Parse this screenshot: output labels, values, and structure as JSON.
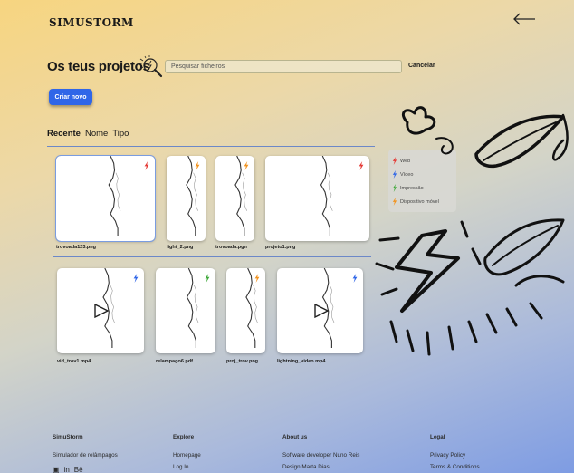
{
  "brand": "SIMUSTORM",
  "header": {
    "title": "Os teus projetos"
  },
  "search": {
    "placeholder": "Pesquisar ficheiros",
    "value": "",
    "cancel_label": "Cancelar"
  },
  "new_button_label": "Criar novo",
  "sort_tabs": [
    "Recente",
    "Nome",
    "Tipo"
  ],
  "colors": {
    "web": "#e53935",
    "video": "#2f66e8",
    "print": "#3fa93a",
    "mobile": "#f2931e",
    "button": "#2f66e8"
  },
  "legend": [
    {
      "label": "Web",
      "type": "web"
    },
    {
      "label": "Vídeo",
      "type": "video"
    },
    {
      "label": "Impressão",
      "type": "print"
    },
    {
      "label": "Dispositivo móvel",
      "type": "mobile"
    }
  ],
  "projects": [
    {
      "name": "trovoada123.png",
      "type": "web",
      "video": false
    },
    {
      "name": "light_2.png",
      "type": "mobile",
      "video": false
    },
    {
      "name": "trovoada.pgn",
      "type": "mobile",
      "video": false
    },
    {
      "name": "projeto1.png",
      "type": "web",
      "video": false
    },
    {
      "name": "vid_trov1.mp4",
      "type": "video",
      "video": true
    },
    {
      "name": "relampago6.pdf",
      "type": "print",
      "video": false
    },
    {
      "name": "proj_trov.png",
      "type": "mobile",
      "video": false
    },
    {
      "name": "lightning_video.mp4",
      "type": "video",
      "video": true
    }
  ],
  "footer": {
    "columns": [
      {
        "title": "SimuStorm",
        "items": [
          "Simulador de relâmpagos"
        ]
      },
      {
        "title": "Explore",
        "items": [
          "Homepage",
          "Log In"
        ]
      },
      {
        "title": "About us",
        "items": [
          "Software developer Nuno Reis",
          "Design Marta Dias"
        ]
      },
      {
        "title": "Legal",
        "items": [
          "Privacy Policy",
          "Terms & Conditions"
        ]
      }
    ],
    "social": [
      "instagram-icon",
      "linkedin-icon",
      "behance-icon"
    ]
  }
}
